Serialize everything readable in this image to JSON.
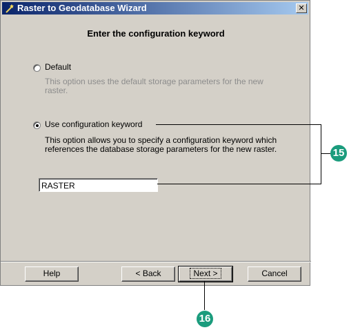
{
  "window": {
    "title": "Raster to Geodatabase Wizard",
    "close_glyph": "✕"
  },
  "heading": "Enter the configuration keyword",
  "options": [
    {
      "label": "Default",
      "description": "This option uses the default storage parameters for the new raster.",
      "checked": false
    },
    {
      "label": "Use configuration keyword",
      "description": "This option allows you to specify a configuration keyword which references the database storage parameters for the new raster.",
      "checked": true
    }
  ],
  "keyword_field": {
    "value": "RASTER"
  },
  "buttons": {
    "help": "Help",
    "back": "< Back",
    "next": "Next >",
    "cancel": "Cancel"
  },
  "callouts": {
    "step_15": "15",
    "step_16": "16",
    "badge_color": "#1b9c7d"
  }
}
